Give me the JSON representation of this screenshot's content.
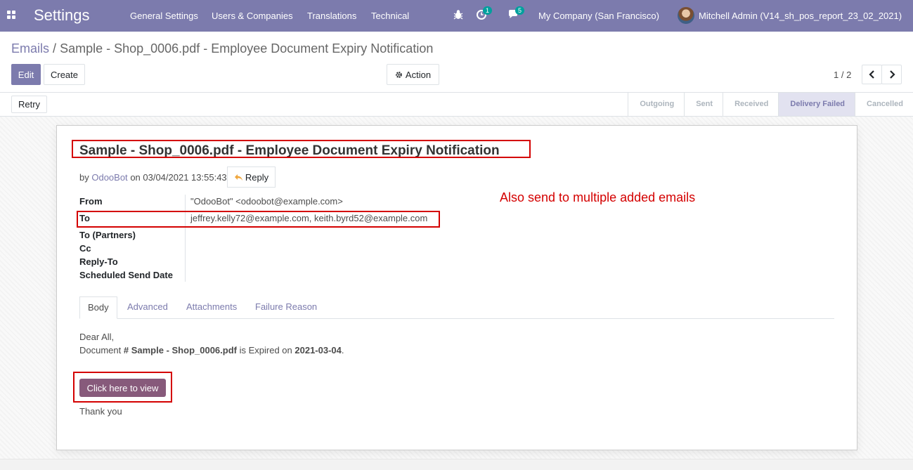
{
  "navbar": {
    "brand": "Settings",
    "menu": [
      "General Settings",
      "Users & Companies",
      "Translations",
      "Technical"
    ],
    "activity_count": "1",
    "messages_count": "5",
    "company": "My Company (San Francisco)",
    "user": "Mitchell Admin (V14_sh_pos_report_23_02_2021)",
    "icons": [
      "apps-grid-icon",
      "bug-icon",
      "clock-icon",
      "chat-icon"
    ]
  },
  "breadcrumb": {
    "parent": "Emails",
    "separator": "/",
    "current": "Sample - Shop_0006.pdf - Employee Document Expiry Notification"
  },
  "toolbar": {
    "edit_label": "Edit",
    "create_label": "Create",
    "action_label": "Action",
    "pager": "1 / 2"
  },
  "statusbar": {
    "retry_label": "Retry",
    "stages": [
      "Outgoing",
      "Sent",
      "Received",
      "Delivery Failed",
      "Cancelled"
    ],
    "active_stage": "Delivery Failed"
  },
  "email": {
    "subject": "Sample - Shop_0006.pdf - Employee Document Expiry Notification",
    "by_prefix": "by",
    "author": "OdooBot",
    "date_text": "on 03/04/2021 13:55:43",
    "reply_label": "Reply",
    "fields": {
      "from_label": "From",
      "from_value": "\"OdooBot\" <odoobot@example.com>",
      "to_label": "To",
      "to_value": "jeffrey.kelly72@example.com, keith.byrd52@example.com",
      "to_partners_label": "To (Partners)",
      "cc_label": "Cc",
      "reply_to_label": "Reply-To",
      "scheduled_label": "Scheduled Send Date"
    },
    "tabs": [
      "Body",
      "Advanced",
      "Attachments",
      "Failure Reason"
    ],
    "active_tab": "Body",
    "body": {
      "greeting": "Dear All,",
      "line_prefix": "Document",
      "doc_ref": "# Sample - Shop_0006.pdf",
      "line_middle": "is Expired on",
      "expiry_date": "2021-03-04",
      "line_suffix": ".",
      "view_button": "Click here to view",
      "closing": "Thank you"
    }
  },
  "annotation": "Also send to multiple added emails",
  "colors": {
    "primary": "#7c7bad",
    "button_purple": "#875a7b",
    "annotation_red": "#d40000"
  }
}
